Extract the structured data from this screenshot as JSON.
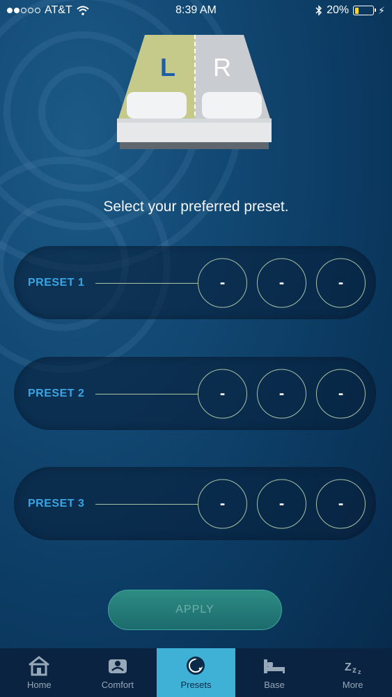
{
  "status_bar": {
    "carrier": "AT&T",
    "time": "8:39 AM",
    "battery_percent": "20%",
    "signal_strength": 2,
    "battery_level": 0.2
  },
  "bed": {
    "left_label": "L",
    "right_label": "R",
    "selected_side": "left"
  },
  "prompt": "Select your preferred preset.",
  "presets": [
    {
      "label": "PRESET 1",
      "values": [
        "-",
        "-",
        "-"
      ]
    },
    {
      "label": "PRESET 2",
      "values": [
        "-",
        "-",
        "-"
      ]
    },
    {
      "label": "PRESET 3",
      "values": [
        "-",
        "-",
        "-"
      ]
    }
  ],
  "apply_label": "APPLY",
  "tabs": [
    {
      "label": "Home",
      "icon": "home-icon",
      "active": false
    },
    {
      "label": "Comfort",
      "icon": "comfort-icon",
      "active": false
    },
    {
      "label": "Presets",
      "icon": "moon-icon",
      "active": true
    },
    {
      "label": "Base",
      "icon": "bed-icon",
      "active": false
    },
    {
      "label": "More",
      "icon": "zzz-icon",
      "active": false
    }
  ],
  "colors": {
    "accent": "#3fb1d6",
    "preset_label": "#3aa5e4",
    "left_side": "#c5c98a",
    "apply": "#2e8c84"
  }
}
